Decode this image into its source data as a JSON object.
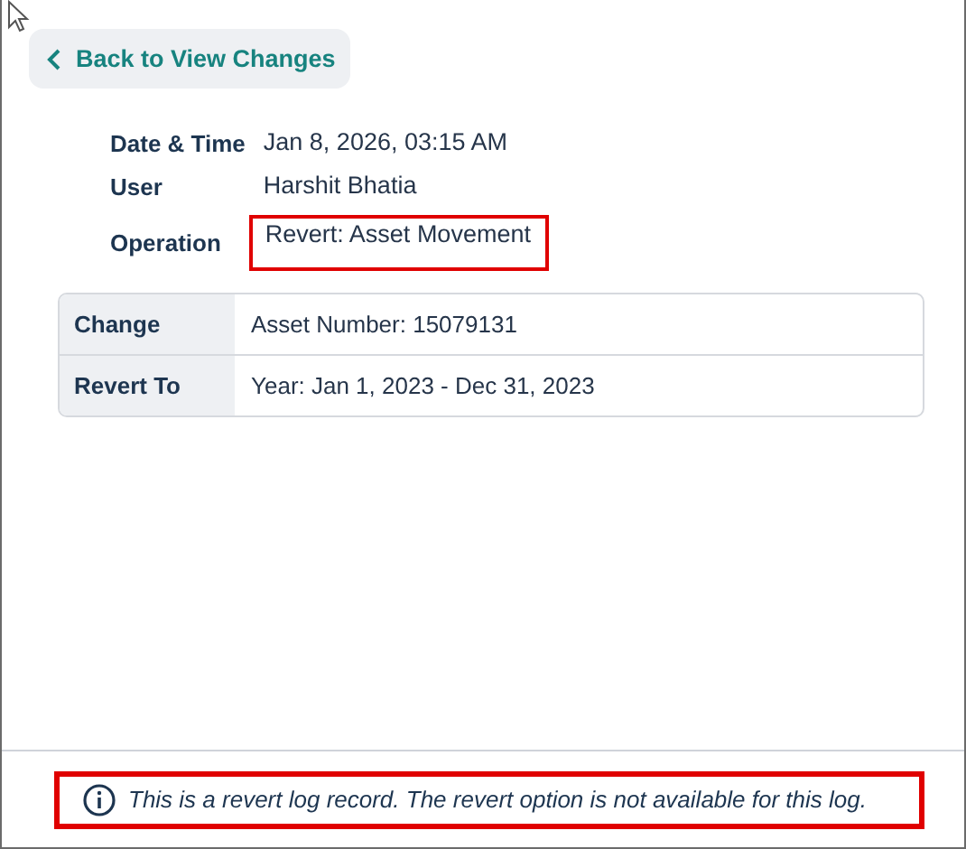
{
  "back_button": {
    "label": "Back to View Changes"
  },
  "details": [
    {
      "label": "Date & Time",
      "value": "Jan 8, 2026, 03:15 AM",
      "highlighted": false
    },
    {
      "label": "User",
      "value": "Harshit Bhatia",
      "highlighted": false
    },
    {
      "label": "Operation",
      "value": "Revert: Asset Movement",
      "highlighted": true
    }
  ],
  "changes_table": {
    "rows": [
      {
        "label": "Change",
        "value": "Asset Number: 15079131"
      },
      {
        "label": "Revert To",
        "value": "Year: Jan 1, 2023 - Dec 31, 2023"
      }
    ]
  },
  "notice": {
    "text": "This is a revert log record. The revert option is not available for this log.",
    "highlighted": true
  }
}
